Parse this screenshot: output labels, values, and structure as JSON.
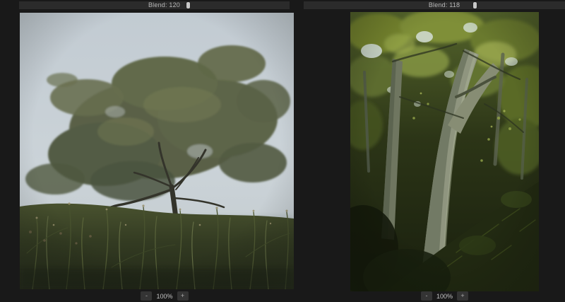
{
  "window": {
    "background": "#191919",
    "toolbar_color": "#2b2b2b",
    "text_color": "#b8b8b8",
    "slider_thumb_color": "#c9c9c9",
    "button_color": "#343434"
  },
  "panels": [
    {
      "id": "left",
      "toolbar": {
        "blend_label": "Blend: 120",
        "blend_value": 120,
        "slider_thumb_left": "62%"
      },
      "photo": {
        "description": "Lone windswept tree with a broad dark-green canopy standing in fog above a tall grass meadow, pale blue-grey sky"
      },
      "zoombar": {
        "zoom_out": "-",
        "zoom_level": "100%",
        "zoom_in": "+"
      }
    },
    {
      "id": "right",
      "toolbar": {
        "blend_label": "Blend: 118",
        "blend_value": 118,
        "slider_thumb_left": "64.9%"
      },
      "photo": {
        "description": "Grey beech tree trunks leaning through a sunlit green forest canopy above a dark mossy slope"
      },
      "zoombar": {
        "zoom_out": "-",
        "zoom_level": "100%",
        "zoom_in": "+"
      }
    }
  ]
}
